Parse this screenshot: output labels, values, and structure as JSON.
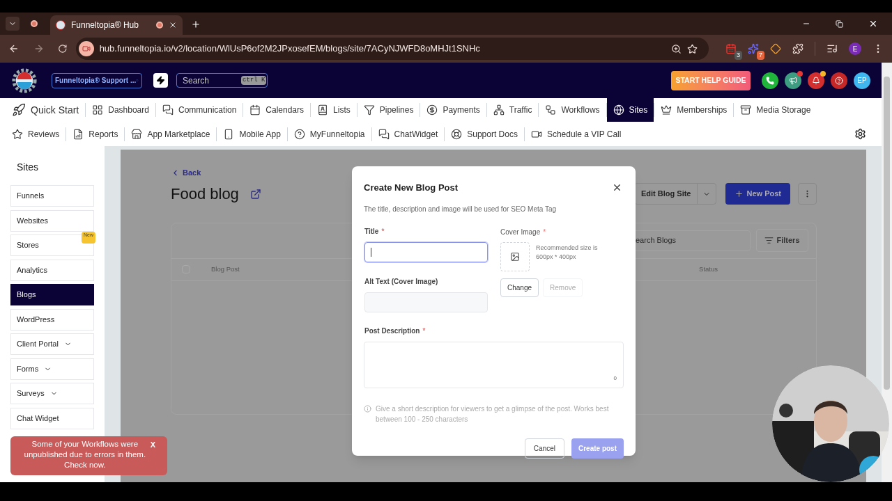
{
  "browser": {
    "tab_title": "Funneltopia® Hub",
    "url": "hub.funneltopia.io/v2/location/WlUsP6of2M2JPxosefEM/blogs/site/7ACyNJWFD8oMHJt1SNHc",
    "extensions": [
      {
        "kind": "calendar",
        "badge": "3"
      },
      {
        "kind": "spark",
        "badge": "7"
      },
      {
        "kind": "diamond"
      },
      {
        "kind": "puzzle"
      }
    ],
    "profile": "E"
  },
  "header": {
    "account": "Funneltopia® Support ...",
    "search": {
      "placeholder": "Search",
      "shortcut": "ctrl K"
    },
    "help_button": "START HELP GUIDE",
    "actions": [
      {
        "kind": "phone",
        "color": "#1fb53b",
        "dot": false
      },
      {
        "kind": "megaphone",
        "color": "#3d9d80",
        "dot": true
      },
      {
        "kind": "bell",
        "color": "#d32f2f",
        "dot": true
      },
      {
        "kind": "help",
        "color": "#c62828",
        "dot": false
      }
    ],
    "avatar": "EP"
  },
  "nav": {
    "main": [
      {
        "label": "Quick Start",
        "selected": false
      },
      {
        "label": "Dashboard",
        "selected": false
      },
      {
        "label": "Communication",
        "selected": false
      },
      {
        "label": "Calendars",
        "selected": false
      },
      {
        "label": "Lists",
        "selected": false
      },
      {
        "label": "Pipelines",
        "selected": false
      },
      {
        "label": "Payments",
        "selected": false
      },
      {
        "label": "Traffic",
        "selected": false
      },
      {
        "label": "Workflows",
        "selected": false
      },
      {
        "label": "Sites",
        "selected": true
      },
      {
        "label": "Memberships",
        "selected": false
      },
      {
        "label": "Media Storage",
        "selected": false
      }
    ],
    "more": [
      {
        "label": "Reviews",
        "selected": false
      },
      {
        "label": "Reports",
        "selected": false
      },
      {
        "label": "App Marketplace",
        "selected": false
      },
      {
        "label": "Mobile App",
        "selected": false
      },
      {
        "label": "MyFunneltopia",
        "selected": false
      },
      {
        "label": "ChatWidget",
        "selected": false
      },
      {
        "label": "Support Docs",
        "selected": false
      },
      {
        "label": "Schedule a VIP Call",
        "selected": false
      }
    ]
  },
  "sidebar": {
    "title": "Sites",
    "items": [
      {
        "label": "Funnels",
        "selected": false,
        "menu": false
      },
      {
        "label": "Websites",
        "selected": false,
        "menu": false
      },
      {
        "label": "Stores",
        "selected": false,
        "menu": false,
        "badge": "New"
      },
      {
        "label": "Analytics",
        "selected": false,
        "menu": false
      },
      {
        "label": "Blogs",
        "selected": true,
        "menu": false
      },
      {
        "label": "WordPress",
        "selected": false,
        "menu": false
      },
      {
        "label": "Client Portal",
        "selected": false,
        "menu": true
      },
      {
        "label": "Forms",
        "selected": false,
        "menu": true
      },
      {
        "label": "Surveys",
        "selected": false,
        "menu": true
      },
      {
        "label": "Chat Widget",
        "selected": false,
        "menu": false
      }
    ]
  },
  "page": {
    "back": "Back",
    "title": "Food blog",
    "edit_button": "Edit Blog Site",
    "new_button": "New Post",
    "search": {
      "placeholder": "earch Blogs"
    },
    "select_all": {
      "checked": false
    },
    "filters": "Filters",
    "columns": [
      "Blog Post",
      "Status"
    ]
  },
  "modal": {
    "title": "Create New Blog Post",
    "subtitle": "The title, description and image will be used for SEO Meta Tag",
    "title_field": {
      "label": "Title",
      "required_mark": "*",
      "focused": true
    },
    "alt_field": {
      "label": "Alt Text (Cover Image)",
      "focused": false
    },
    "cover": {
      "label": "Cover Image",
      "required_mark": "*",
      "hint": "Recommended size is 600px * 400px",
      "buttons": [
        {
          "label": "Change",
          "disabled": false
        },
        {
          "label": "Remove",
          "disabled": true
        }
      ]
    },
    "description": {
      "label": "Post Description",
      "required_mark": "*",
      "counter": "0",
      "hint": "Give a short description for viewers to get a glimpse of the post. Works best between 100 - 250 characters"
    },
    "cancel": "Cancel",
    "submit": {
      "label": "Create post",
      "disabled": true
    }
  },
  "toast": {
    "message": "Some of your Workflows were unpublished due to errors in them. Check now.",
    "close": "X"
  }
}
